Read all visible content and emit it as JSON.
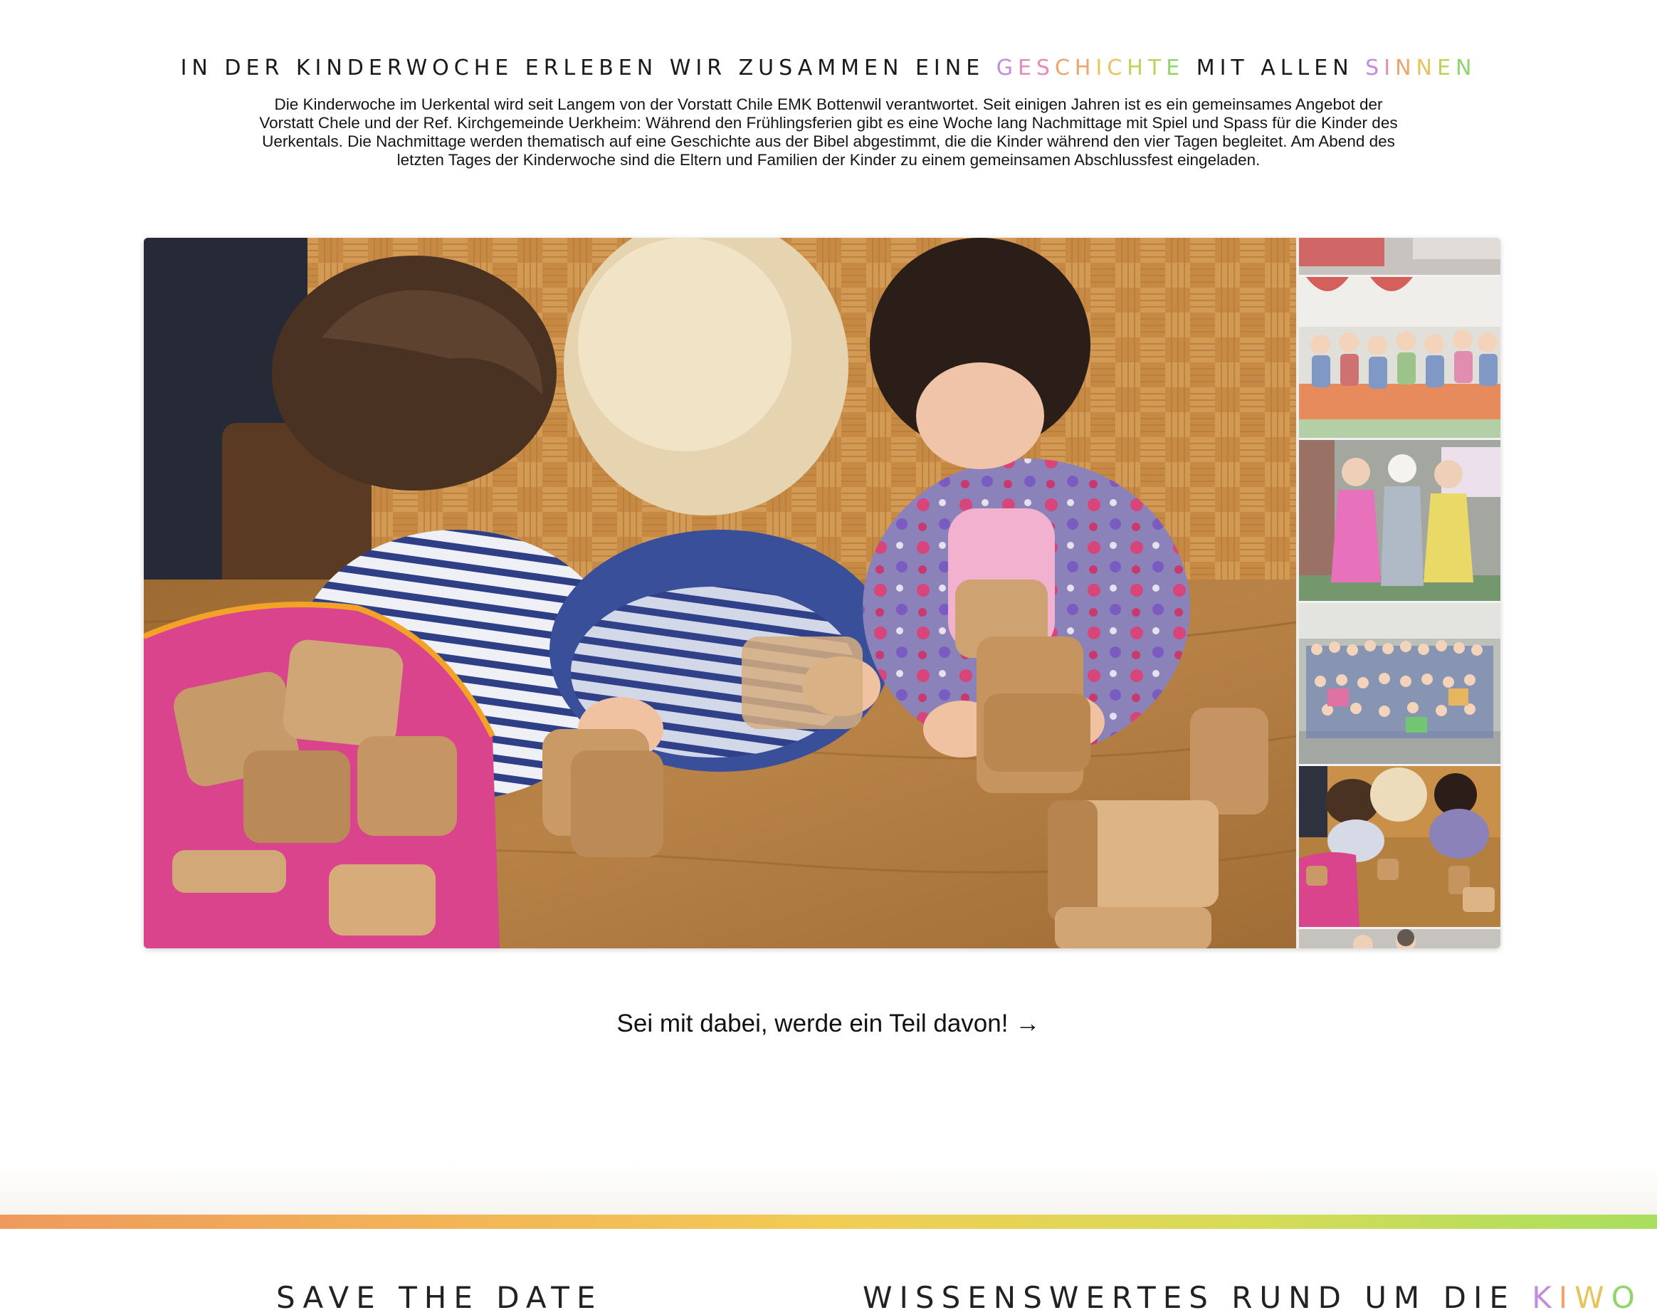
{
  "intro": {
    "title_prefix": "IN DER KINDERWOCHE ERLEBEN WIR ZUSAMMEN EINE ",
    "title_word1": "GESCHICHTE",
    "title_middle": " MIT ALLEN ",
    "title_word2": "SINNEN",
    "rainbow_colors": [
      "#c38be0",
      "#e88ab6",
      "#f0a36b",
      "#e9c25c",
      "#c2cf5a",
      "#8fd56a"
    ],
    "paragraph": "Die Kinderwoche im Uerkental wird seit Langem von der Vorstatt Chile EMK Bottenwil verantwortet. Seit einigen Jahren ist es ein gemeinsames Angebot der Vorstatt Chele und der Ref. Kirchgemeinde Uerkheim: Während den Frühlingsferien gibt es eine Woche lang Nachmittage mit Spiel und Spass für die Kinder des Uerkentals. Die Nachmittage werden thematisch auf eine Geschichte aus der Bibel abgestimmt, die die Kinder während den vier Tagen begleitet. Am Abend des letzten Tages der Kinderwoche sind die Eltern und Familien der Kinder zu einem gemeinsamen Abschlussfest eingeladen."
  },
  "gallery": {
    "main_image": "children-playing-with-wooden-blocks",
    "thumbnails": [
      "event-hall-thumbnail",
      "children-sitting-on-mats-thumbnail",
      "costumed-storytellers-thumbnail",
      "group-photo-thumbnail",
      "children-with-blocks-thumbnail",
      "child-portrait-thumbnail"
    ],
    "active_index": 4
  },
  "cta": {
    "label": "Sei mit dabei, werde ein Teil davon!",
    "arrow": "→"
  },
  "footer": {
    "left_heading": "SAVE THE DATE",
    "right_heading_prefix": "WISSENSWERTES RUND UM DIE ",
    "right_heading_word": "KIWO"
  }
}
